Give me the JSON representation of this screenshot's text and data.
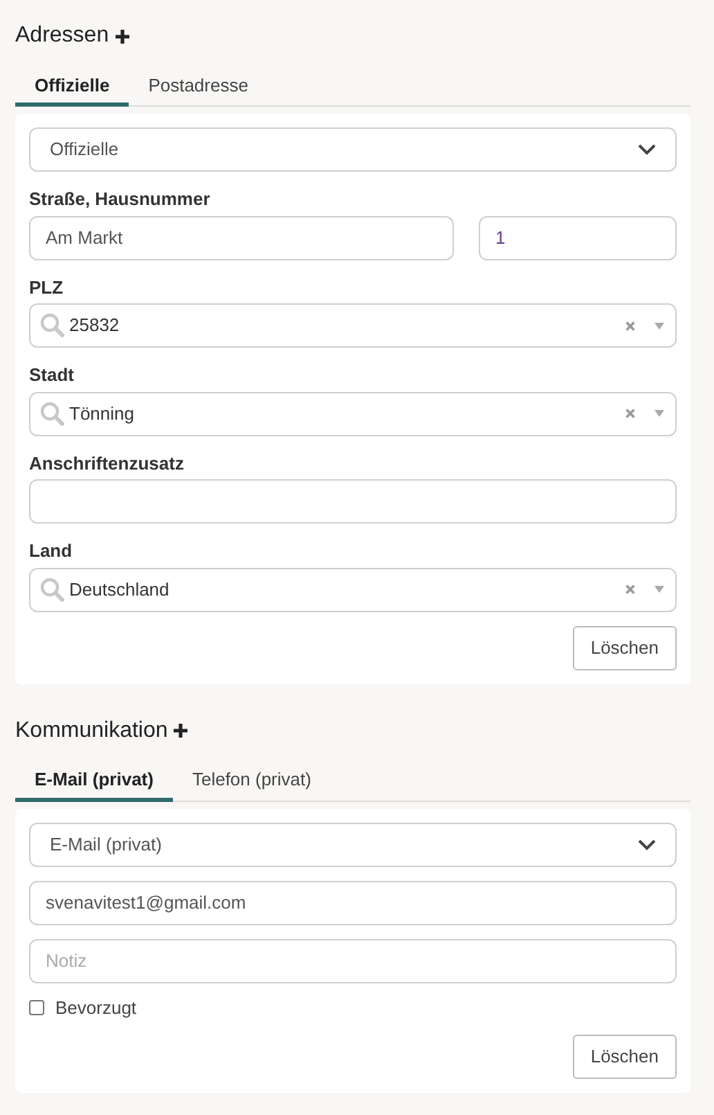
{
  "sections": [
    {
      "title": "Adressen",
      "tabs": [
        {
          "label": "Offizielle",
          "selected": true
        },
        {
          "label": "Postadresse",
          "selected": false
        }
      ],
      "type_select": {
        "value": "Offizielle"
      },
      "fields": [
        {
          "kind": "pair",
          "label": "Straße, Hausnummer",
          "values": [
            "Am Markt",
            "1"
          ]
        },
        {
          "kind": "search",
          "label": "PLZ",
          "value": "25832"
        },
        {
          "kind": "search",
          "label": "Stadt",
          "value": "Tönning"
        },
        {
          "kind": "text",
          "label": "Anschriftenzusatz"
        },
        {
          "kind": "search",
          "label": "Land",
          "value": "Deutschland"
        }
      ],
      "delete_button": "Löschen"
    },
    {
      "title": "Kommunikation",
      "tabs": [
        {
          "label": "E-Mail (privat)",
          "selected": true
        },
        {
          "label": "Telefon (privat)",
          "selected": false
        }
      ],
      "type_select": {
        "value": "E-Mail (privat)"
      },
      "fields": [
        {
          "kind": "text",
          "value": "svenavitest1@gmail.com"
        },
        {
          "kind": "text",
          "placeholder": "Notiz"
        },
        {
          "kind": "checkbox",
          "label": "Bevorzugt",
          "checked": false
        }
      ],
      "delete_button": "Löschen"
    }
  ]
}
